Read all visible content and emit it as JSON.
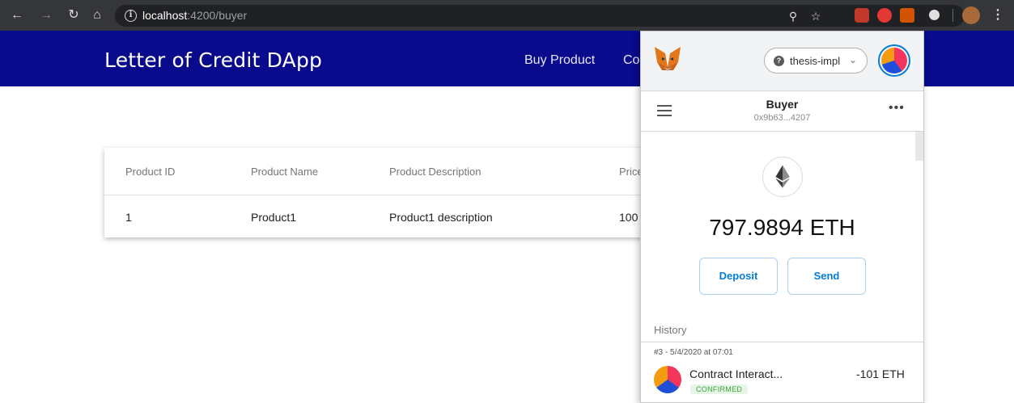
{
  "browser": {
    "url_host": "localhost",
    "url_rest": ":4200/buyer"
  },
  "app": {
    "title": "Letter of Credit DApp",
    "nav": [
      "Buy Product",
      "Co"
    ]
  },
  "table": {
    "headers": [
      "Product ID",
      "Product Name",
      "Product Description",
      "Price"
    ],
    "rows": [
      [
        "1",
        "Product1",
        "Product1 description",
        "100"
      ]
    ]
  },
  "metamask": {
    "network": "thesis-impl",
    "account_name": "Buyer",
    "account_address": "0x9b63...4207",
    "balance": "797.9894 ETH",
    "deposit_label": "Deposit",
    "send_label": "Send",
    "history_label": "History",
    "transactions": [
      {
        "date": "#3 - 5/4/2020 at 07:01",
        "title": "Contract Interact...",
        "amount": "-101 ETH",
        "status": "CONFIRMED"
      }
    ]
  },
  "colors": {
    "app_header": "#090a8c",
    "metamask_blue": "#037dd6",
    "confirmed_green": "#3fa03f"
  },
  "icons": [
    "back-arrow-icon",
    "forward-arrow-icon",
    "reload-icon",
    "home-icon",
    "info-icon",
    "zoom-icon",
    "star-icon",
    "metamask-fox-icon",
    "ethereum-icon",
    "hamburger-menu-icon",
    "kebab-menu-icon"
  ]
}
